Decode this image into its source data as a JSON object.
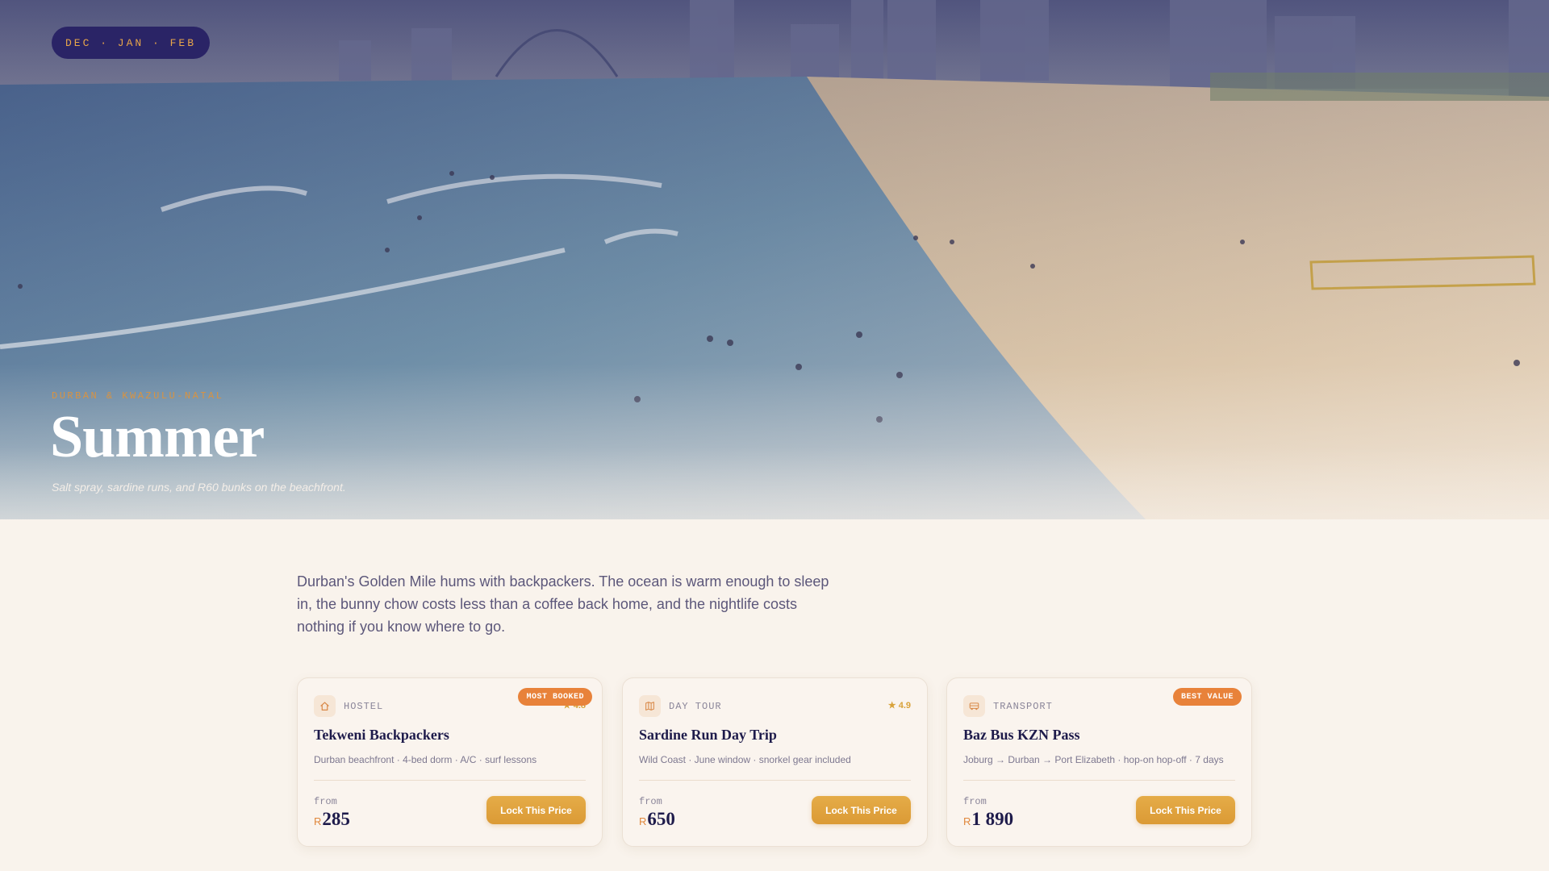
{
  "hero": {
    "season": "DEC · JAN · FEB",
    "kicker": "DURBAN & KWAZULU-NATAL",
    "title": "Summer",
    "subtitle": "Salt spray, sardine runs, and R60 bunks on the beachfront."
  },
  "intro": "Durban's Golden Mile hums with backpackers. The ocean is warm enough to sleep in, the bunny chow costs less than a coffee back home, and the nightlife costs nothing if you know where to go.",
  "cards": [
    {
      "category": "HOSTEL",
      "icon": "home-icon",
      "badge": "MOST BOOKED",
      "rating": "★ 4.8",
      "title": "Tekweni Backpackers",
      "meta": "Durban beachfront · 4-bed dorm · A/C · surf lessons",
      "from_label": "from",
      "currency": "R",
      "price": "285",
      "button": "Lock This Price"
    },
    {
      "category": "DAY TOUR",
      "icon": "map-icon",
      "badge": "",
      "rating": "★ 4.9",
      "title": "Sardine Run Day Trip",
      "meta": "Wild Coast · June window · snorkel gear included",
      "from_label": "from",
      "currency": "R",
      "price": "650",
      "button": "Lock This Price"
    },
    {
      "category": "TRANSPORT",
      "icon": "bus-icon",
      "badge": "BEST VALUE",
      "rating": "",
      "title": "Baz Bus KZN Pass",
      "meta": "Joburg → Durban → Port Elizabeth · hop-on hop-off · 7 days",
      "from_label": "from",
      "currency": "R",
      "price": "1 890",
      "button": "Lock This Price"
    }
  ],
  "colors": {
    "accent": "#e8823a",
    "button": "#db9a35",
    "navy": "#1e1b4b",
    "background": "#f9f3ec"
  }
}
